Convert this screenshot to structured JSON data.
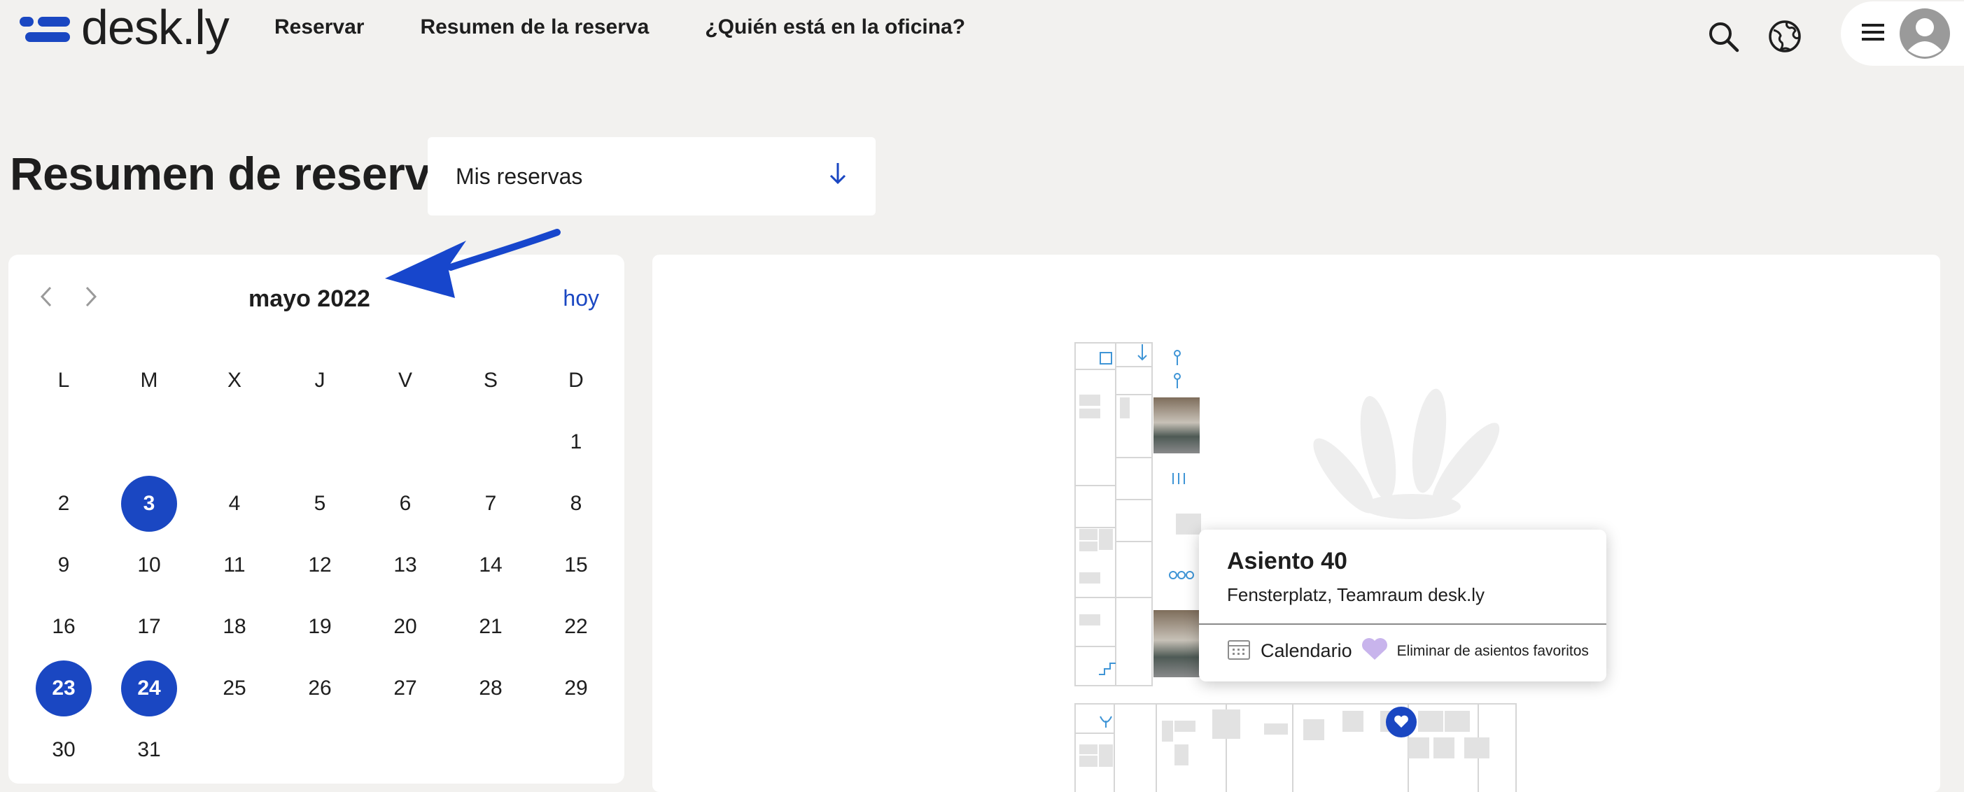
{
  "app": {
    "logo_text": "desk.ly",
    "brand_color": "#1a47c2"
  },
  "nav": {
    "items": [
      "Reservar",
      "Resumen de la reserva",
      "¿Quién está en la oficina?"
    ]
  },
  "icons": {
    "search": "search-icon",
    "language": "globe-icon",
    "menu": "hamburger-icon",
    "user": "avatar-icon"
  },
  "header": {
    "title": "Resumen de reserva",
    "filter_value": "Mis reservas"
  },
  "calendar": {
    "month_label": "mayo 2022",
    "today_label": "hoy",
    "weekdays": [
      "L",
      "M",
      "X",
      "J",
      "V",
      "S",
      "D"
    ],
    "days": [
      [
        "",
        "",
        "",
        "",
        "",
        "",
        "1"
      ],
      [
        "2",
        "3",
        "4",
        "5",
        "6",
        "7",
        "8"
      ],
      [
        "9",
        "10",
        "11",
        "12",
        "13",
        "14",
        "15"
      ],
      [
        "16",
        "17",
        "18",
        "19",
        "20",
        "21",
        "22"
      ],
      [
        "23",
        "24",
        "25",
        "26",
        "27",
        "28",
        "29"
      ],
      [
        "30",
        "31",
        "",
        "",
        "",
        "",
        ""
      ]
    ],
    "selected_days": [
      "3",
      "23",
      "24"
    ]
  },
  "popup": {
    "seat_title": "Asiento 40",
    "location": "Fensterplatz, Teamraum desk.ly",
    "calendar_label": "Calendario",
    "favorite_label": "Eliminar de asientos favoritos"
  }
}
